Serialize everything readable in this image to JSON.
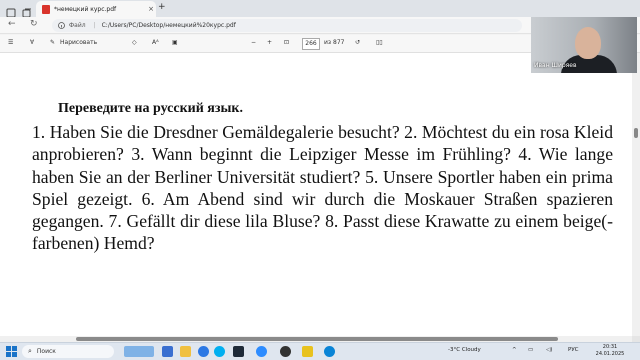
{
  "browser": {
    "tab_title": "*немецкий курс.pdf",
    "tab_close": "×",
    "new_tab": "+",
    "address_label": "Файл",
    "address_sep": "|",
    "url": "C:/Users/PC/Desktop/немецкий%20курс.pdf"
  },
  "pdf_toolbar": {
    "draw_label": "Нарисовать",
    "text_tool": "Aᴬ",
    "zoom_minus": "−",
    "zoom_plus": "+",
    "page_current": "266",
    "page_total": "из 877"
  },
  "document": {
    "heading": "Переведите на русский язык.",
    "body": "1. Haben Sie die Dresdner Gemäldegalerie besucht? 2. Möchtest du ein rosa Kleid anprobieren? 3. Wann beginnt die Leipziger Messe im Frühling? 4. Wie lange haben Sie an der Berliner Universität studiert? 5. Unsere Sportler haben ein prima Spiel gezeigt. 6. Am Abend sind wir durch die Moskauer Straßen spazieren gegangen. 7. Gefällt dir diese lila Bluse? 8. Passt diese Krawatte zu einem beige(-farbenen) Hemd?"
  },
  "webcam": {
    "name": "Иван Ширяев"
  },
  "taskbar": {
    "search_label": "Поиск",
    "weather": "-3°C  Cloudy",
    "lang": "РУС",
    "time": "20:31",
    "date": "24.01.2025"
  },
  "colors": {
    "accent": "#1a73c8",
    "pdf_red": "#d9342b"
  }
}
